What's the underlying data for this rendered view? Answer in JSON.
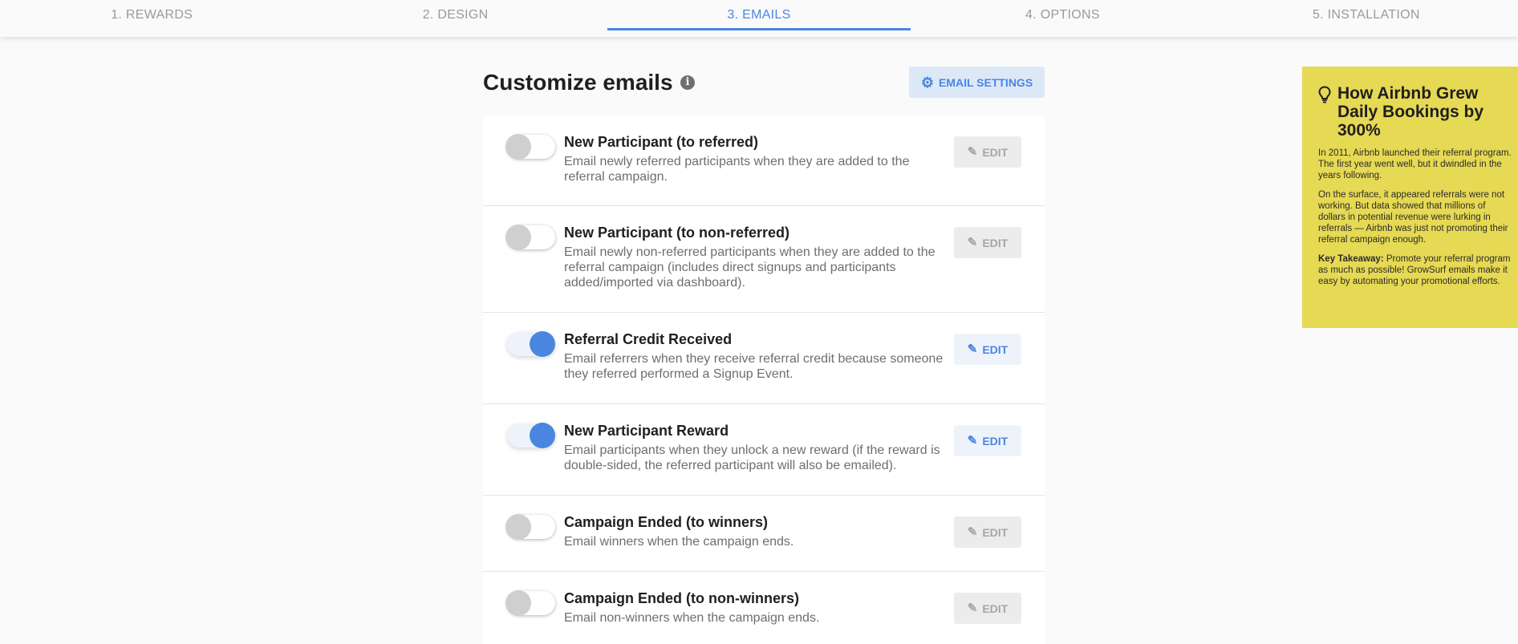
{
  "steps": [
    {
      "label": "1. REWARDS"
    },
    {
      "label": "2. DESIGN"
    },
    {
      "label": "3. EMAILS"
    },
    {
      "label": "4. OPTIONS"
    },
    {
      "label": "5. INSTALLATION"
    }
  ],
  "active_step": 2,
  "header": {
    "title": "Customize emails",
    "info_icon": "info-icon",
    "settings_button": {
      "label": "EMAIL SETTINGS",
      "icon": "gear-icon"
    }
  },
  "emails": [
    {
      "title": "New Participant (to referred)",
      "description": "Email newly referred participants when they are added to the referral campaign.",
      "enabled": false,
      "edit_label": "EDIT"
    },
    {
      "title": "New Participant (to non-referred)",
      "description": "Email newly non-referred participants when they are added to the referral campaign (includes direct signups and participants added/imported via dashboard).",
      "enabled": false,
      "edit_label": "EDIT"
    },
    {
      "title": "Referral Credit Received",
      "description": "Email referrers when they receive referral credit because someone they referred performed a Signup Event.",
      "enabled": true,
      "edit_label": "EDIT"
    },
    {
      "title": "New Participant Reward",
      "description": "Email participants when they unlock a new reward (if the reward is double-sided, the referred participant will also be emailed).",
      "enabled": true,
      "edit_label": "EDIT"
    },
    {
      "title": "Campaign Ended (to winners)",
      "description": "Email winners when the campaign ends.",
      "enabled": false,
      "edit_label": "EDIT"
    },
    {
      "title": "Campaign Ended (to non-winners)",
      "description": "Email non-winners when the campaign ends.",
      "enabled": false,
      "edit_label": "EDIT"
    }
  ],
  "tip": {
    "icon": "lightbulb-icon",
    "title": "How Airbnb Grew Daily Bookings by 300%",
    "paragraph1": "In 2011, Airbnb launched their referral program. The first year went well, but it dwindled in the years following.",
    "paragraph2": "On the surface, it appeared referrals were not working. But data showed that millions of dollars in potential revenue were lurking in referrals — Airbnb was just not promoting their referral campaign enough.",
    "takeaway_label": "Key Takeaway:",
    "takeaway_text": " Promote your referral program as much as possible! GrowSurf emails make it easy by automating your promotional efforts."
  },
  "colors": {
    "accent": "#4a86e0",
    "tip_background": "#e6d953",
    "page_background": "#fafafa"
  }
}
